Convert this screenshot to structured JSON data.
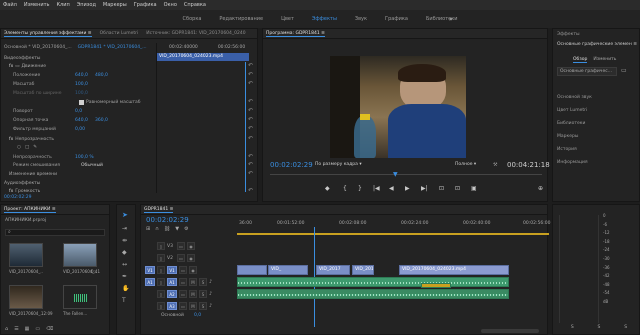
{
  "menu": [
    "Файл",
    "Изменить",
    "Клип",
    "Эпизод",
    "Маркеры",
    "Графика",
    "Окно",
    "Справка"
  ],
  "workspaces": [
    "Сборка",
    "Редактирование",
    "Цвет",
    "Эффекты",
    "Звук",
    "Графика",
    "Библиотеки"
  ],
  "workspaces_more": "»",
  "effect_controls": {
    "tabs": [
      "Элементы управления эффектами ≡",
      "Области Lumetri",
      "Источник: GDPR1841: VID_20170604_0240"
    ],
    "source_label": "Основной * VID_20170604_...",
    "clip_label": "GDPR1841 * VID_20170604_...",
    "ruler": [
      "00:02:40000",
      "00:02:56:00"
    ],
    "clip_bar": "VID_20170604_024023.mp4",
    "section_video": "Видеоэффекты",
    "fx_motion": "Движение",
    "rows": [
      {
        "label": "Положение",
        "v1": "640,0",
        "v2": "480,0"
      },
      {
        "label": "Масштаб",
        "v1": "100,0",
        "v2": ""
      },
      {
        "label": "Масштаб по ширине",
        "v1": "100,0",
        "v2": ""
      },
      {
        "label": "Равномерный масштаб",
        "v1": "",
        "v2": ""
      },
      {
        "label": "Поворот",
        "v1": "0,0",
        "v2": ""
      },
      {
        "label": "Опорная точка",
        "v1": "640,0",
        "v2": "360,0"
      },
      {
        "label": "Фильтр мерцаний",
        "v1": "0,00",
        "v2": ""
      }
    ],
    "fx_opacity": "Непрозрачность",
    "opacity_label": "Непрозрачность",
    "opacity_value": "100,0 %",
    "blend_label": "Режим смешивания",
    "blend_value": "Обычный",
    "time_remap": "Изменение времени",
    "section_audio": "Аудиоэффекты",
    "volume": "Громкость",
    "timecode": "00:02:02:29"
  },
  "program": {
    "tab": "Программа: GDPR1841 ≡",
    "timecode": "00:02:02:29",
    "fit": "По размеру кадра",
    "quality": "Полное",
    "duration": "00:04:21:18"
  },
  "transport": [
    "◆",
    "{",
    "}",
    "|◀",
    "◀",
    "▶",
    "▶|",
    "⊡",
    "⊡",
    "▣",
    "⊕"
  ],
  "project": {
    "tab": "Проект: АПКИНИКИ ≡",
    "file": "АПКИНИКИ.prproj",
    "thumbs": [
      "VID_20170604_...",
      "VID_20170604_...",
      "VID_20170604_...",
      "The Fallen..."
    ],
    "thumb_times": [
      "",
      "0:41",
      "12:09",
      ""
    ]
  },
  "timeline": {
    "tab": "GDPR1841 ≡",
    "timecode": "00:02:02:29",
    "ruler": [
      "36:00",
      "00:01:52:00",
      "00:02:08:00",
      "00:02:24:00",
      "00:02:40:00",
      "00:02:56:00"
    ],
    "video_tracks": [
      "V3",
      "V2",
      "V1"
    ],
    "audio_tracks": [
      "A1",
      "A2",
      "A3"
    ],
    "source_v": "V1",
    "source_a": "A1",
    "master": "Основной",
    "master_val": "0,0",
    "clips": [
      "VID_",
      "VID_2017",
      "VID_2017",
      "VID_20170604_024023.mp4"
    ]
  },
  "right_panel": {
    "title": "Эффекты",
    "essential": "Основные графические элемен ≡",
    "tabs": [
      "Обзор",
      "Изменить"
    ],
    "dropdown": "Основные графичес...",
    "items": [
      "Основной звук",
      "Цвет Lumetri",
      "Библиотеки",
      "Маркеры",
      "История",
      "Информация"
    ]
  },
  "meter_labels": [
    "0",
    "-6",
    "-12",
    "-18",
    "-24",
    "-30",
    "-36",
    "-42",
    "-48",
    "-54",
    "dB"
  ],
  "meter_footer": [
    "S",
    "S",
    "S"
  ],
  "colors": {
    "accent": "#3a8ee0",
    "clip_video": "#7a8fc7",
    "clip_audio": "#3e9a6e"
  }
}
